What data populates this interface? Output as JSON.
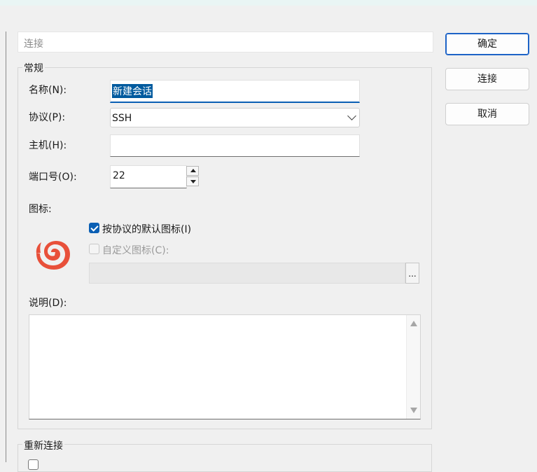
{
  "window": {
    "header_value": "连接"
  },
  "buttons": {
    "ok": "确定",
    "connect": "连接",
    "cancel": "取消"
  },
  "general": {
    "title": "常规",
    "name_label": "名称(N):",
    "name_value": "新建会话",
    "protocol_label": "协议(P):",
    "protocol_value": "SSH",
    "host_label": "主机(H):",
    "host_value": "",
    "port_label": "端口号(O):",
    "port_value": "22",
    "icon_label": "图标:",
    "default_icon_label": "按协议的默认图标(I)",
    "default_icon_checked": true,
    "custom_icon_label": "自定义图标(C):",
    "custom_icon_checked": false,
    "custom_icon_path": "",
    "browse_label": "...",
    "description_label": "说明(D):",
    "description_value": ""
  },
  "reconnect": {
    "title": "重新连接"
  },
  "colors": {
    "accent": "#0a5fb4",
    "icon": "#e8503a"
  },
  "icons": {
    "protocol_icon": "shell-spiral-icon",
    "dropdown": "chevron-down-icon",
    "spin_up": "arrow-up-icon",
    "spin_down": "arrow-down-icon",
    "scroll_up": "scroll-up-icon",
    "scroll_down": "scroll-down-icon"
  }
}
